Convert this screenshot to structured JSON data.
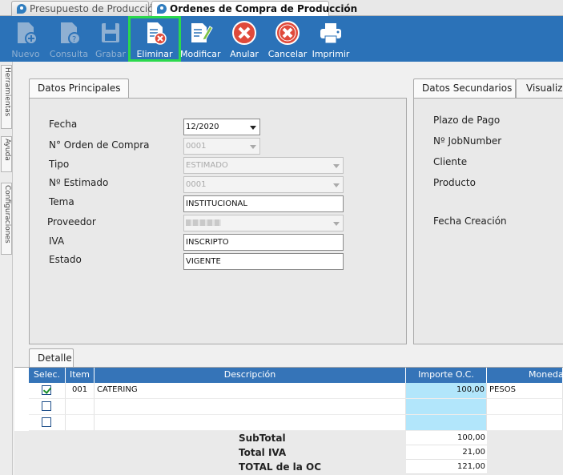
{
  "window_tabs": [
    {
      "label": "Presupuesto de Producción"
    },
    {
      "label": "Ordenes de Compra de Producción"
    }
  ],
  "toolbar": {
    "nuevo": "Nuevo",
    "consulta": "Consulta",
    "grabar": "Grabar",
    "eliminar": "Eliminar",
    "modificar": "Modificar",
    "anular": "Anular",
    "cancelar": "Cancelar",
    "imprimir": "Imprimir"
  },
  "side_tabs": {
    "herramientas": "Herramientas",
    "ayuda": "Ayuda",
    "configuraciones": "Configuraciones"
  },
  "datos_principales": {
    "tab": "Datos Principales",
    "fecha_label": "Fecha",
    "fecha_value": "12/2020",
    "orden_label": "N° Orden de Compra",
    "orden_value": "0001",
    "tipo_label": "Tipo",
    "tipo_value": "ESTIMADO",
    "estimado_label": "Nº Estimado",
    "estimado_value": "0001",
    "tema_label": "Tema",
    "tema_value": "INSTITUCIONAL",
    "proveedor_label": "Proveedor",
    "iva_label": "IVA",
    "iva_value": "INSCRIPTO",
    "estado_label": "Estado",
    "estado_value": "VIGENTE"
  },
  "datos_secundarios": {
    "tab": "Datos Secundarios",
    "tab2": "Visualiza",
    "plazo": "Plazo de Pago",
    "jobnumber": "Nº JobNumber",
    "cliente": "Cliente",
    "producto": "Producto",
    "fecha_creacion": "Fecha Creación"
  },
  "detalle": {
    "tab": "Detalle",
    "columns": [
      "Selec.",
      "Item",
      "Descripción",
      "Importe O.C.",
      "Moneda"
    ],
    "rows": [
      {
        "selected": true,
        "item": "001",
        "descripcion": "CATERING",
        "importe": "100,00",
        "moneda": "PESOS"
      },
      {
        "selected": false,
        "item": "",
        "descripcion": "",
        "importe": "",
        "moneda": ""
      },
      {
        "selected": false,
        "item": "",
        "descripcion": "",
        "importe": "",
        "moneda": ""
      }
    ],
    "subtotal_label": "SubTotal",
    "subtotal_value": "100,00",
    "iva_label": "Total IVA",
    "iva_value": "21,00",
    "total_label": "TOTAL de la OC",
    "total_value": "121,00"
  },
  "colors": {
    "toolbar": "#2b72b8",
    "selection_outline": "#2bd94c",
    "grid_header": "#3574b8",
    "import_cell": "#b2e6fb"
  }
}
